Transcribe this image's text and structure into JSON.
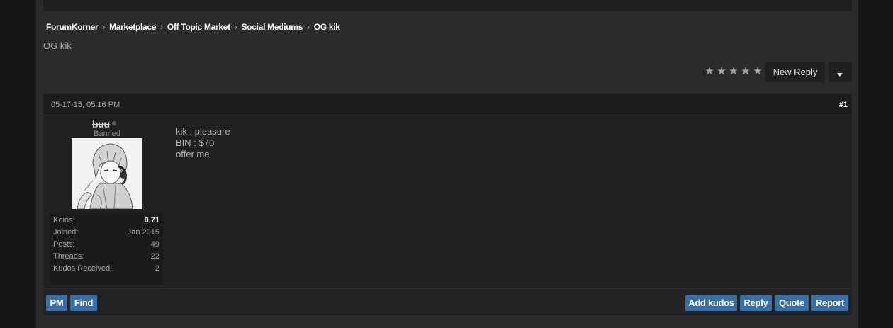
{
  "breadcrumb": [
    "ForumKorner",
    "Marketplace",
    "Off Topic Market",
    "Social Mediums",
    "OG kik"
  ],
  "breadcrumb_separator": "›",
  "thread_title": "OG kik",
  "rating_stars": [
    "★",
    "★",
    "★",
    "★",
    "★"
  ],
  "toolbar": {
    "new_reply_label": "New Reply"
  },
  "post": {
    "date": "05-17-15, 05:16 PM",
    "number": "#1",
    "username": "buu",
    "user_title": "Banned",
    "stats": [
      {
        "label": "Koins:",
        "value": "0.71"
      },
      {
        "label": "Joined:",
        "value": "Jan 2015"
      },
      {
        "label": "Posts:",
        "value": "49"
      },
      {
        "label": "Threads:",
        "value": "22"
      },
      {
        "label": "Kudos Received:",
        "value": "2"
      }
    ],
    "body_lines": [
      "kik : pleasure",
      "BIN : $70",
      "offer me"
    ],
    "buttons": {
      "pm": "PM",
      "find": "Find",
      "add_kudos": "Add kudos",
      "reply": "Reply",
      "quote": "Quote",
      "report": "Report"
    }
  },
  "colors": {
    "button_blue": "#3a6ea5",
    "page_bg": "#2b2b2b",
    "post_bg": "#212121"
  }
}
